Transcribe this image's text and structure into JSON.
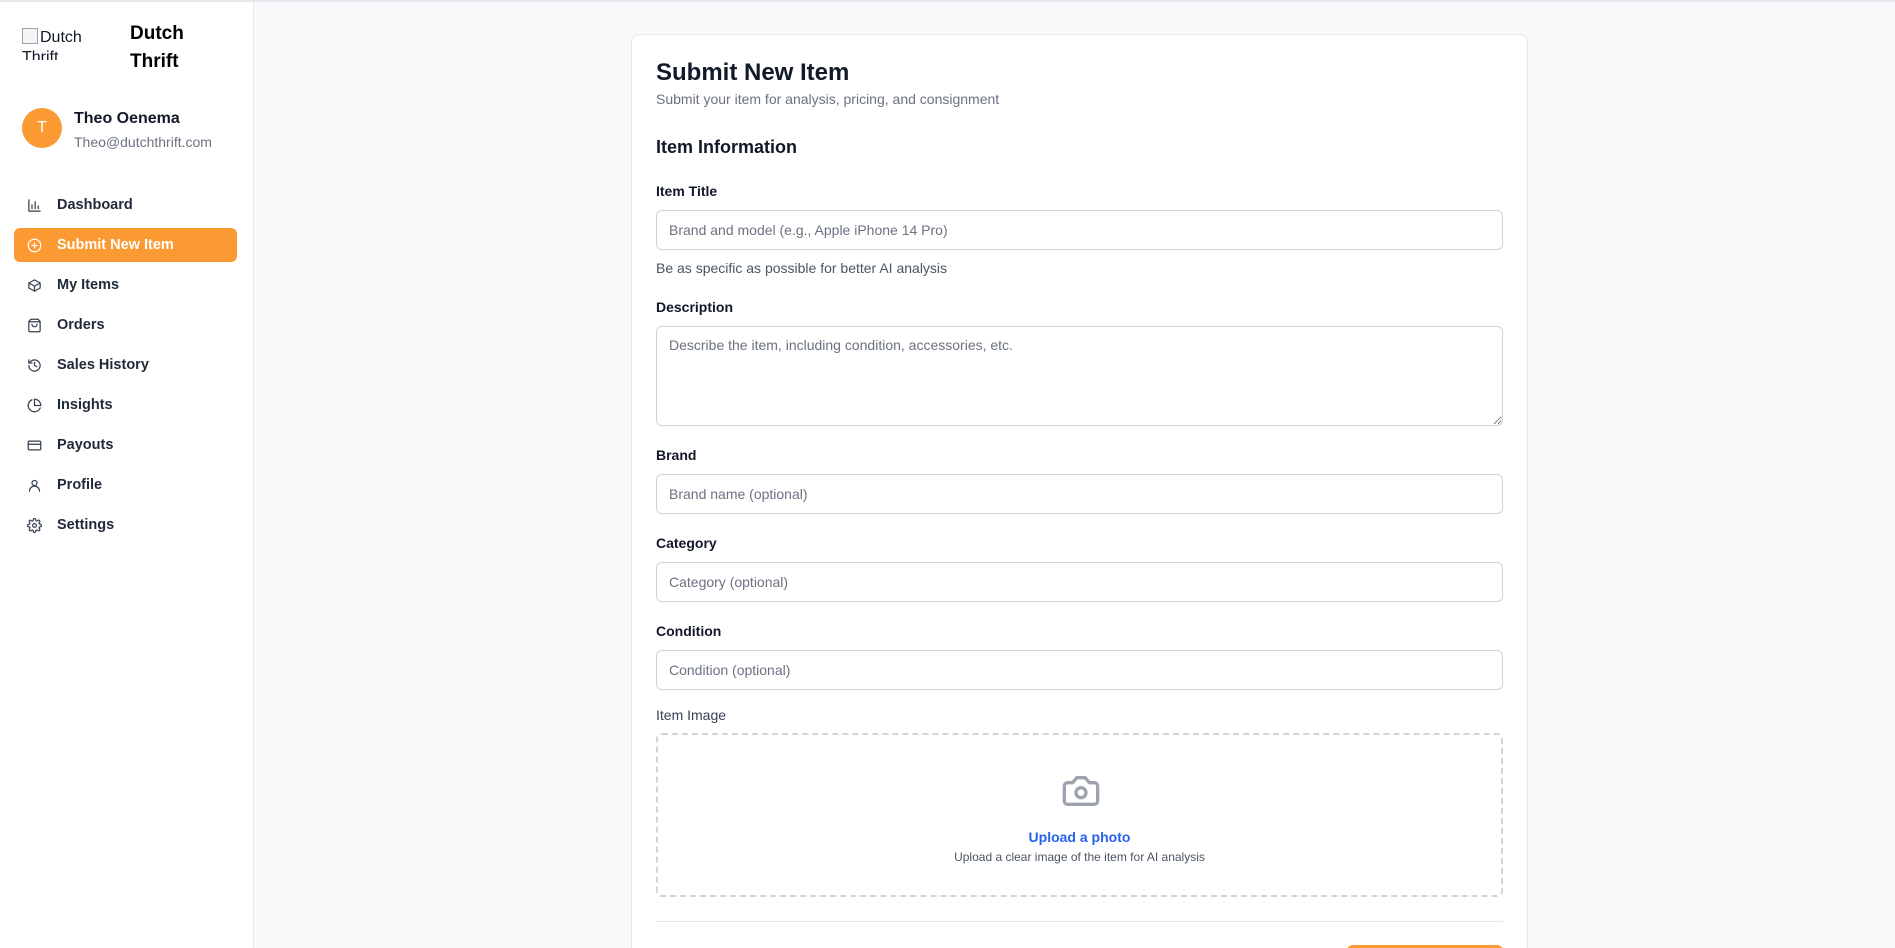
{
  "brand": {
    "logo_alt": "Dutch Thrift",
    "name_line1": "Dutch",
    "name_line2": "Thrift"
  },
  "user": {
    "initial": "T",
    "name": "Theo Oenema",
    "email": "Theo@dutchthrift.com"
  },
  "nav": [
    {
      "label": "Dashboard",
      "icon": "bar-chart-icon",
      "active": false
    },
    {
      "label": "Submit New Item",
      "icon": "plus-circle-icon",
      "active": true
    },
    {
      "label": "My Items",
      "icon": "package-icon",
      "active": false
    },
    {
      "label": "Orders",
      "icon": "shopping-bag-icon",
      "active": false
    },
    {
      "label": "Sales History",
      "icon": "history-icon",
      "active": false
    },
    {
      "label": "Insights",
      "icon": "pie-chart-icon",
      "active": false
    },
    {
      "label": "Payouts",
      "icon": "credit-card-icon",
      "active": false
    },
    {
      "label": "Profile",
      "icon": "user-icon",
      "active": false
    },
    {
      "label": "Settings",
      "icon": "gear-icon",
      "active": false
    }
  ],
  "form": {
    "title": "Submit New Item",
    "subtitle": "Submit your item for analysis, pricing, and consignment",
    "section": "Item Information",
    "item_title": {
      "label": "Item Title",
      "placeholder": "Brand and model (e.g., Apple iPhone 14 Pro)",
      "value": "",
      "hint": "Be as specific as possible for better AI analysis"
    },
    "description": {
      "label": "Description",
      "placeholder": "Describe the item, including condition, accessories, etc.",
      "value": ""
    },
    "brand": {
      "label": "Brand",
      "placeholder": "Brand name (optional)",
      "value": ""
    },
    "category": {
      "label": "Category",
      "placeholder": "Category (optional)",
      "value": ""
    },
    "condition": {
      "label": "Condition",
      "placeholder": "Condition (optional)",
      "value": ""
    },
    "image": {
      "label": "Item Image",
      "icon": "camera-icon",
      "upload_link": "Upload a photo",
      "upload_hint": "Upload a clear image of the item for AI analysis"
    }
  },
  "colors": {
    "accent": "#fb9a32",
    "link": "#2563eb"
  }
}
